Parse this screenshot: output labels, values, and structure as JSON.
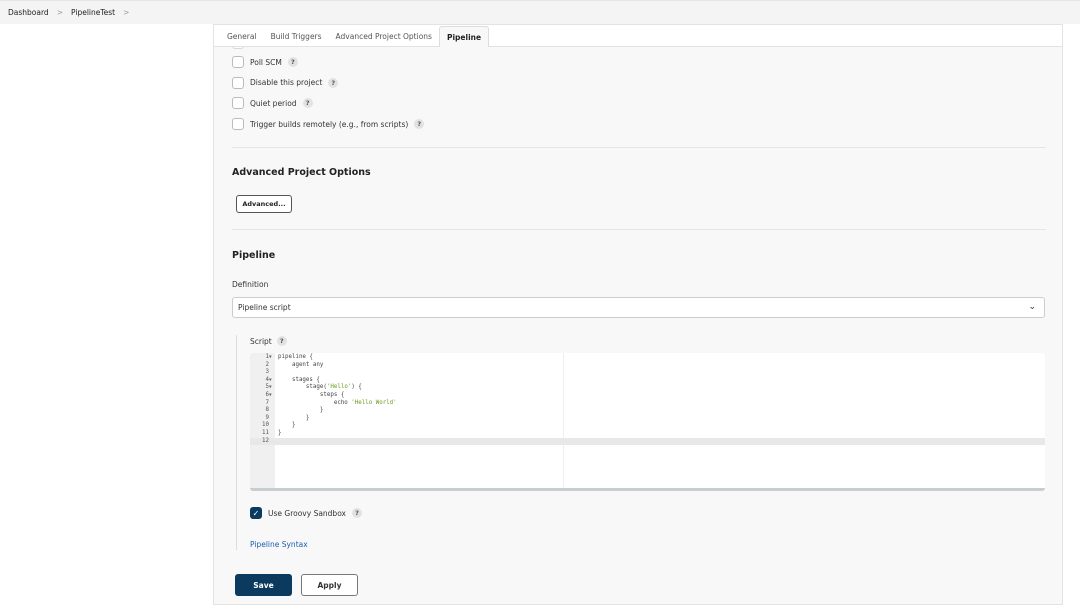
{
  "breadcrumb": [
    "Dashboard",
    "PipelineTest"
  ],
  "tabs": [
    "General",
    "Build Triggers",
    "Advanced Project Options",
    "Pipeline"
  ],
  "triggers": [
    "Poll SCM",
    "Disable this project",
    "Quiet period",
    "Trigger builds remotely (e.g., from scripts)"
  ],
  "advanced": {
    "title": "Advanced Project Options",
    "button": "Advanced..."
  },
  "pipeline": {
    "title": "Pipeline",
    "definition_label": "Definition",
    "definition_value": "Pipeline script",
    "script_label": "Script",
    "code": [
      {
        "n": "1",
        "fold": true,
        "segs": [
          [
            "pipeline {",
            ""
          ]
        ]
      },
      {
        "n": "2",
        "segs": [
          [
            "    agent any",
            ""
          ]
        ]
      },
      {
        "n": "3",
        "segs": [
          [
            "",
            ""
          ]
        ]
      },
      {
        "n": "4",
        "fold": true,
        "segs": [
          [
            "    stages {",
            ""
          ]
        ]
      },
      {
        "n": "5",
        "fold": true,
        "segs": [
          [
            "        stage(",
            ""
          ],
          [
            "'Hello'",
            "str"
          ],
          [
            ") {",
            ""
          ]
        ]
      },
      {
        "n": "6",
        "fold": true,
        "segs": [
          [
            "            steps {",
            ""
          ]
        ]
      },
      {
        "n": "7",
        "segs": [
          [
            "                echo ",
            ""
          ],
          [
            "'Hello World'",
            "str"
          ]
        ]
      },
      {
        "n": "8",
        "segs": [
          [
            "            }",
            ""
          ]
        ]
      },
      {
        "n": "9",
        "segs": [
          [
            "        }",
            ""
          ]
        ]
      },
      {
        "n": "10",
        "segs": [
          [
            "    }",
            ""
          ]
        ]
      },
      {
        "n": "11",
        "segs": [
          [
            "}",
            ""
          ]
        ]
      },
      {
        "n": "12",
        "active": true,
        "segs": [
          [
            "",
            ""
          ]
        ]
      }
    ],
    "sandbox_label": "Use Groovy Sandbox",
    "sandbox_checked": true,
    "syntax_link": "Pipeline Syntax"
  },
  "buttons": {
    "save": "Save",
    "apply": "Apply"
  },
  "help_glyph": "?",
  "colors": {
    "primary": "#0c3a5e",
    "link": "#1a5fb4",
    "string": "#6a9a1f"
  }
}
